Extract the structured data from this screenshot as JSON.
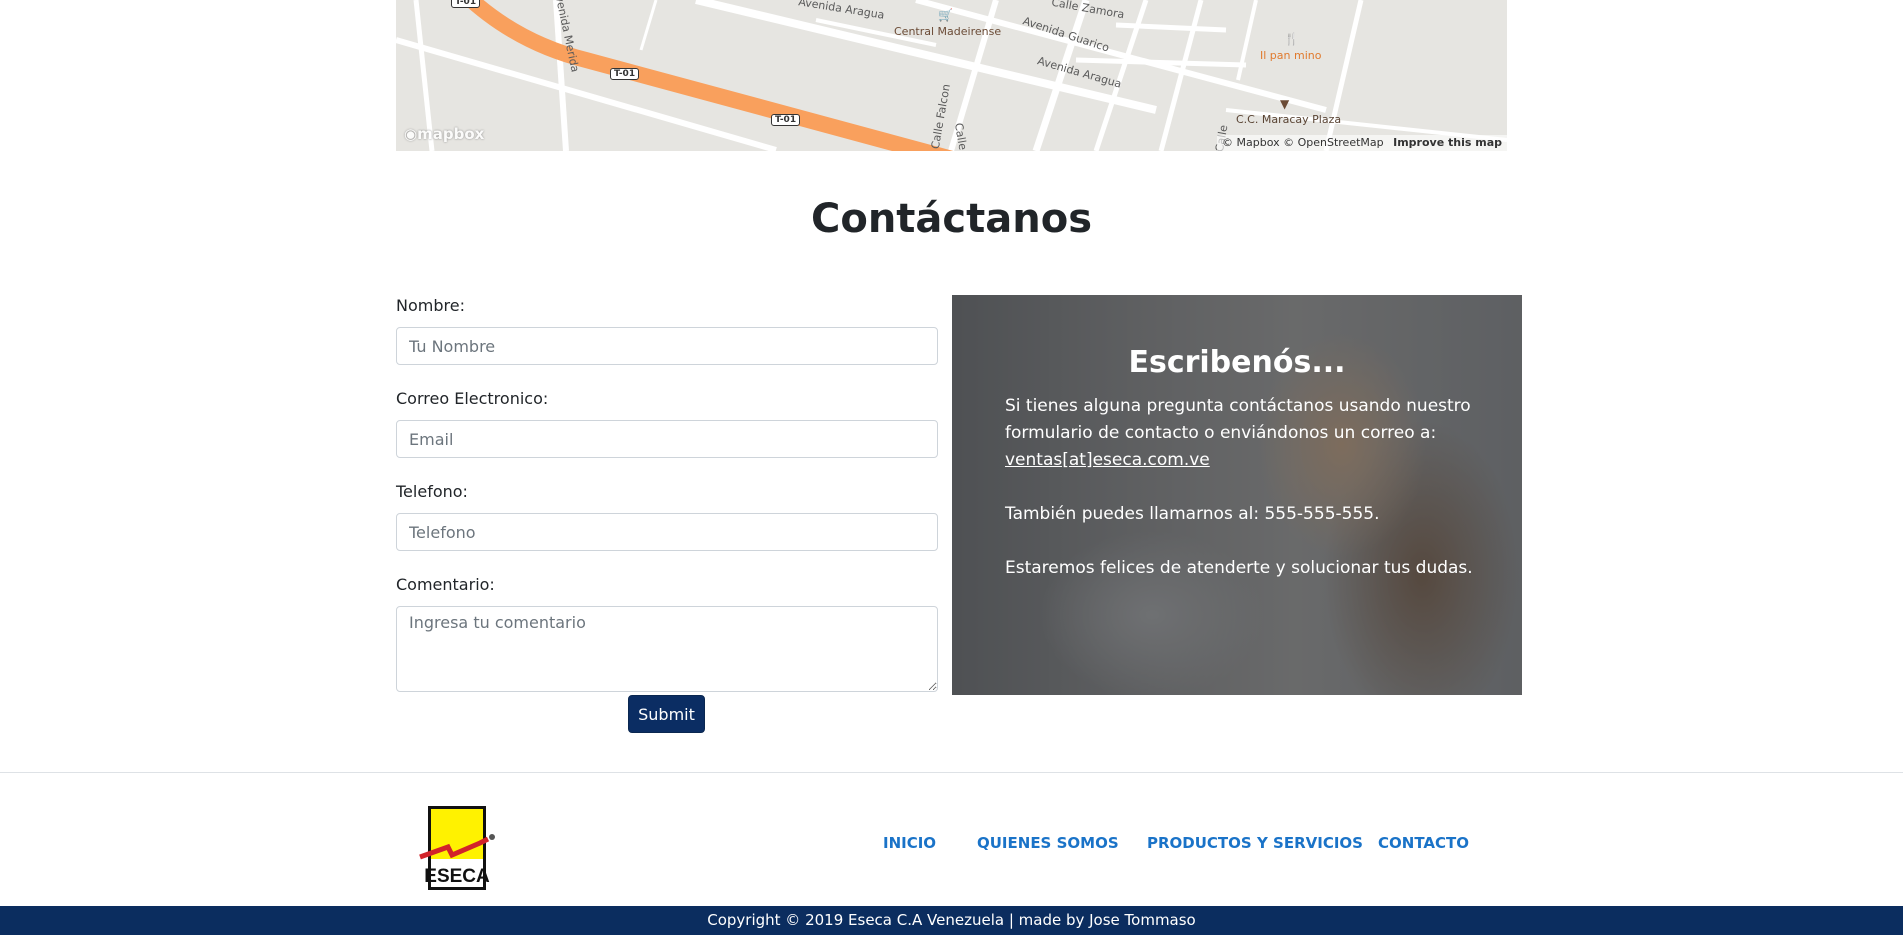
{
  "map": {
    "labels": {
      "avenida_aragua_top": "Avenida Aragua",
      "avenida_aragua": "Avenida Aragua",
      "avenida_guarico": "Avenida Guarico",
      "calle_zamora": "Calle Zamora",
      "avenida_merida": "Avenida Merida",
      "calle_falcon": "Calle Falcon",
      "calle": "Calle",
      "calle2": "Calle"
    },
    "shields": [
      "T-01",
      "T-01",
      "T-01"
    ],
    "pois": {
      "central_madeirense": "Central Madeirense",
      "il_pan_mino": "Il pan mino",
      "cc_maracay_plaza": "C.C. Maracay Plaza"
    },
    "logo": "mapbox",
    "attribution": "© Mapbox © OpenStreetMap",
    "improve": "Improve this map"
  },
  "heading": "Contáctanos",
  "form": {
    "name_label": "Nombre:",
    "name_placeholder": "Tu Nombre",
    "email_label": "Correo Electronico:",
    "email_placeholder": "Email",
    "phone_label": "Telefono:",
    "phone_placeholder": "Telefono",
    "comment_label": "Comentario:",
    "comment_placeholder": "Ingresa tu comentario",
    "submit_label": "Submit"
  },
  "panel": {
    "title": "Escribenós...",
    "paragraph1": "Si tienes alguna pregunta contáctanos usando nuestro formulario de contacto o enviándonos un correo a:",
    "email_link": "ventas[at]eseca.com.ve",
    "paragraph2": "También puedes llamarnos al: 555-555-555.",
    "paragraph3": "Estaremos felices de atenderte y solucionar tus dudas."
  },
  "footer": {
    "logo_text": "ESECA",
    "nav": [
      "INICIO",
      "QUIENES SOMOS",
      "PRODUCTOS Y SERVICIOS",
      "CONTACTO"
    ],
    "copyright": "Copyright © 2019 Eseca C.A Venezuela | made by Jose Tommaso"
  },
  "colors": {
    "nav_link": "#1a73c8",
    "button": "#0b2d63",
    "footer_bar": "#0b2d5f",
    "map_highway": "#f9a05d"
  }
}
